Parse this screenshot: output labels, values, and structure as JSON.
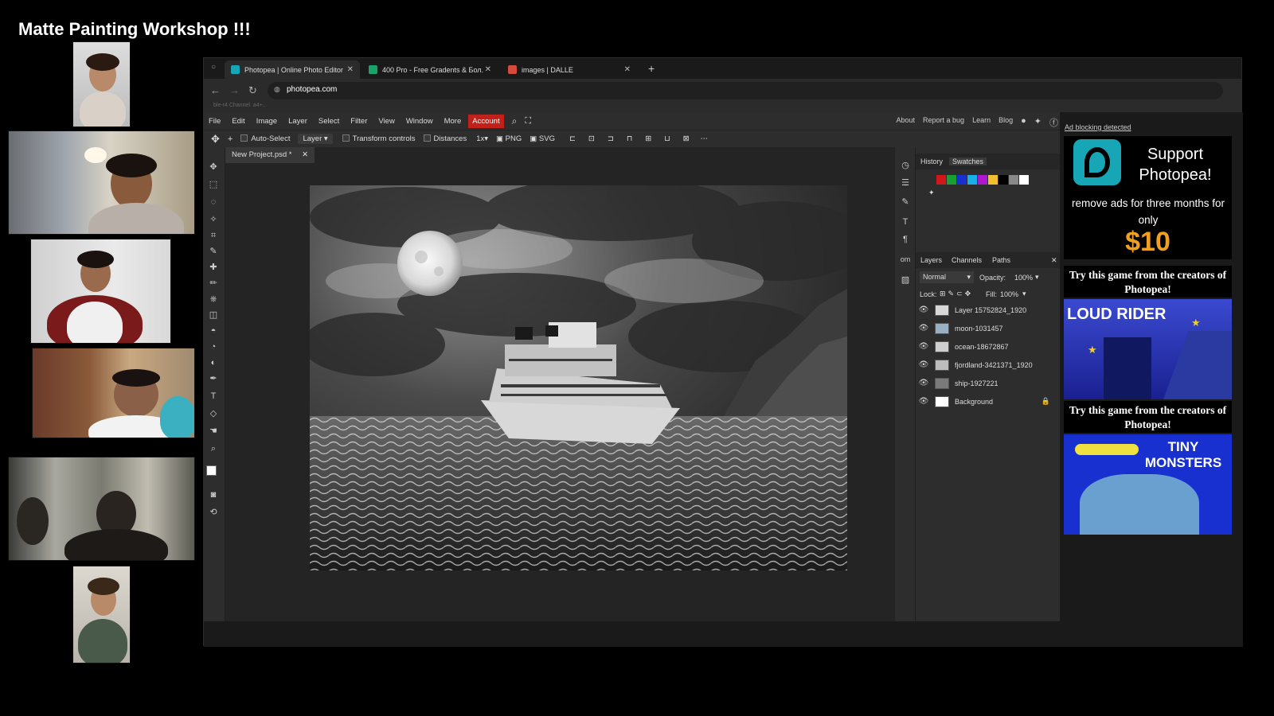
{
  "workshop": {
    "title": "Matte Painting Workshop !!!"
  },
  "participants": [
    {
      "label": "participant-1"
    },
    {
      "label": "participant-2"
    },
    {
      "label": "participant-3"
    },
    {
      "label": "participant-4"
    },
    {
      "label": "participant-5"
    },
    {
      "label": "participant-6"
    }
  ],
  "browser": {
    "tabs": [
      {
        "title": "Photopea | Online Photo Editor",
        "icon": "photopea-icon",
        "color": "#16a6b6"
      },
      {
        "title": "400 Pro - Free Gradents & Бол.",
        "icon": "gradient-icon",
        "color": "#18a36b"
      },
      {
        "title": "images | DALLE",
        "icon": "dalle-icon",
        "color": "#d44b3b"
      }
    ],
    "new_tab": "+",
    "url": "photopea.com",
    "bookmark_hint": "ble-r4  Channel. a4+.."
  },
  "photopea": {
    "menu": [
      "File",
      "Edit",
      "Image",
      "Layer",
      "Select",
      "Filter",
      "View",
      "Window",
      "More"
    ],
    "account": "Account",
    "right_links": [
      "About",
      "Report a bug",
      "Learn",
      "Blog"
    ],
    "options": {
      "auto_select": "Auto-Select",
      "auto_select_target": "Layer",
      "transform_controls": "Transform controls",
      "distances": "Distances",
      "zoom": "1x",
      "png": "PNG",
      "svg": "SVG"
    },
    "document_tab": "New Project.psd *",
    "history_tab": "History",
    "swatches_tab": "Swatches",
    "swatch_colors": [
      "#d01818",
      "#18a030",
      "#1830d0",
      "#18b0e8",
      "#b018d0",
      "#f0c030",
      "#000000",
      "#888888",
      "#ffffff"
    ],
    "layers_tabs": [
      "Layers",
      "Channels",
      "Paths"
    ],
    "blend_mode": "Normal",
    "opacity_label": "Opacity:",
    "opacity_value": "100%",
    "lock_label": "Lock:",
    "fill_label": "Fill:",
    "fill_value": "100%",
    "layers": [
      {
        "name": "Layer 15752824_1920"
      },
      {
        "name": "moon-1031457"
      },
      {
        "name": "ocean-18672867"
      },
      {
        "name": "fjordland-3421371_1920"
      },
      {
        "name": "ship-1927221"
      },
      {
        "name": "Background"
      }
    ]
  },
  "ads": {
    "ad_blocking": "Ad blocking detected",
    "support_title": "Support Photopea!",
    "support_text": "remove ads for three months for only",
    "support_price": "$10",
    "game_banner": "Try this game from the creators of Photopea!",
    "game1_title": "LOUD RIDER",
    "game2_title": "TINY MONSTERS"
  }
}
